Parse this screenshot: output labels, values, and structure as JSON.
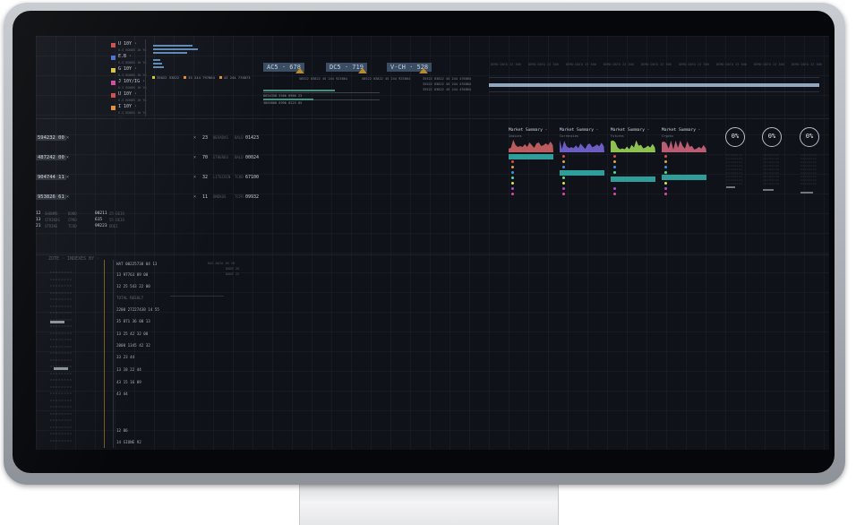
{
  "legend": [
    {
      "label": "U 10Y ·",
      "sub": "U.S BONDS 10 YR ...",
      "color": "#d14b4b"
    },
    {
      "label": "E.B ·",
      "sub": "U.S BONDS 10 YR ...",
      "color": "#4b6fd1"
    },
    {
      "label": "G 10Y ·",
      "sub": "U.S BONDS 10 YR ...",
      "color": "#d8c33a"
    },
    {
      "label": "J 10Y/IG ·",
      "sub": "U.S BONDS 10 YR ...",
      "color": "#d14b9b"
    },
    {
      "label": "U 10Y ·",
      "sub": "U.S BONDS 10 YR ...",
      "color": "#d14b4b"
    },
    {
      "label": "I 10Y ·",
      "sub": "U.S BONDS 10 YR ...",
      "color": "#e08c35"
    }
  ],
  "bars_footer": [
    {
      "text": "35022 53822",
      "color": "#d8c33a"
    },
    {
      "text": "35 244 797864",
      "color": "#e08c35"
    },
    {
      "text": "43 244 776873",
      "color": "#e08c35"
    }
  ],
  "tags": [
    {
      "label": "AC5 · 678",
      "line1": "58522 03822 45 244 923864"
    },
    {
      "label": "DC5 · 719",
      "line1": "58522 03822 45 244 923864"
    },
    {
      "label": "V-CH · 528",
      "line1": "35522 03822 45 244 476864",
      "line2": "35522 03822 45 244 476864",
      "line3": "35522 03822 45 244 476864"
    }
  ],
  "ac5_rows": [
    {
      "text": "8654358   5566   8966 23"
    },
    {
      "text": "3865868   6990   8223 85"
    }
  ],
  "col_headers": [
    "DEMO DATA 23 300",
    "DEMO DATA 23 300",
    "DEMO DATA 23 300",
    "DEMO DATA 23 300",
    "DEMO DATA 23 300",
    "DEMO DATA 23 300",
    "DEMO DATA 23 300",
    "DEMO DATA 23 300",
    "DEMO DATA 23 300"
  ],
  "left_rows": [
    {
      "id": "594232 00",
      "n": "23",
      "name": "NEVADAS",
      "code": "BALD",
      "val": "01423"
    },
    {
      "id": "487242 00",
      "n": "70",
      "name": "ETHEREU",
      "code": "BALD",
      "val": "00024"
    },
    {
      "id": "904744 11",
      "n": "32",
      "name": "LITECOIN",
      "code": "TCOD",
      "val": "67100"
    },
    {
      "id": "953826 61",
      "n": "11",
      "name": "ONEKOS",
      "code": "TCFR",
      "val": "09932"
    }
  ],
  "summary": [
    {
      "n": "12",
      "a": "SHONMO",
      "b": "BOND",
      "c": "00211",
      "d": "25 DEIO"
    },
    {
      "n": "13",
      "a": "STRIKDS",
      "b": "CPRO",
      "c": "615",
      "d": "55 DEIO"
    },
    {
      "n": "21",
      "a": "STRIKE",
      "b": "TCOD",
      "c": "99223",
      "d": "DDEI"
    }
  ],
  "markets": [
    {
      "title": "Market Summary ·",
      "sub": "Indices",
      "color": "#d86a6a"
    },
    {
      "title": "Market Summary ·",
      "sub": "Currencies",
      "color": "#7b6be0"
    },
    {
      "title": "Market Summary ·",
      "sub": "Futures",
      "color": "#a6e05a"
    },
    {
      "title": "Market Summary ·",
      "sub": "Crypto",
      "color": "#d86a82"
    }
  ],
  "gauges": [
    "0%",
    "0%",
    "0%"
  ],
  "lower": {
    "header": "ZOTE · INDEXES BY ·",
    "lines": [
      "HAT   00225738   04   13",
      "13   97763   89   00",
      "12   25 543   22   00",
      "TOTAL RESULT",
      "2200   27227438   14   55",
      "35   871 36   00   13",
      "13   25 42   32   00",
      "2000   1345 42   32",
      "33   23   44",
      "13   18 22   44",
      "43   15 16   09",
      "43   44",
      "12   86",
      "14   SIONE   92"
    ],
    "side": [
      "KAS DATA 05   CH",
      "DADE   26",
      "DADE   22"
    ]
  }
}
